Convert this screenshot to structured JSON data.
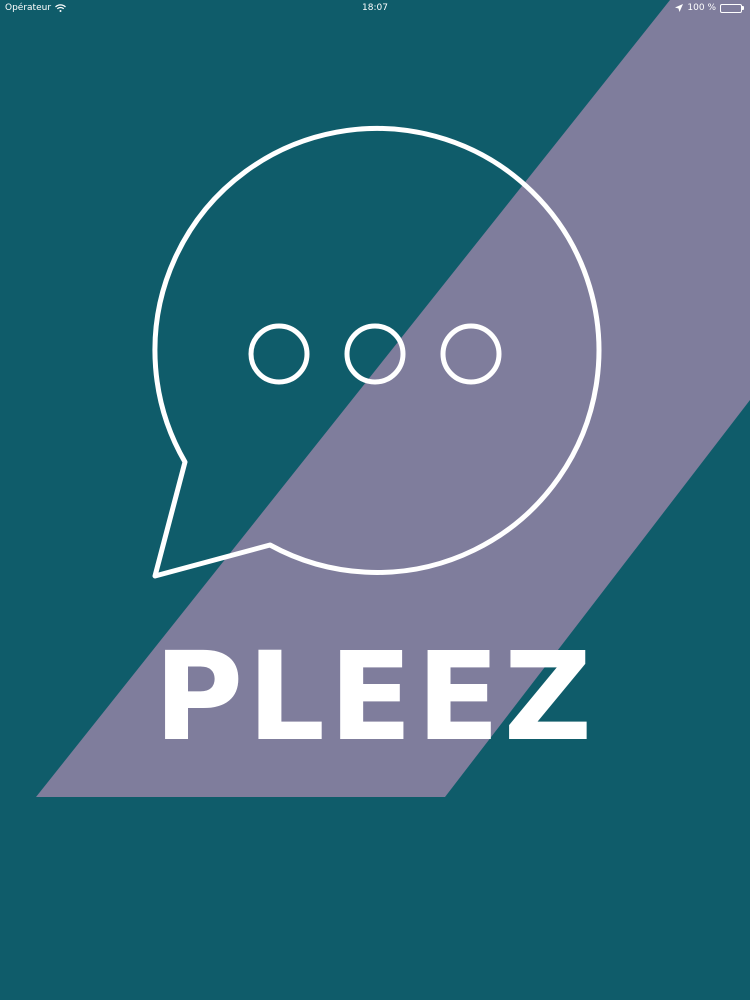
{
  "status_bar": {
    "carrier": "Opérateur",
    "time": "18:07",
    "battery_percent": "100 %",
    "battery_level": 1.0,
    "icons": [
      "wifi-icon",
      "location-arrow-icon",
      "battery-icon"
    ]
  },
  "splash": {
    "app_name": "PLEEZ",
    "logo_icon": "chat-bubble-ellipsis-icon"
  },
  "colors": {
    "background": "#0f5c6a",
    "stripe": "#7f7d9c",
    "logo_stroke": "#ffffff",
    "battery": "#4cd964"
  }
}
